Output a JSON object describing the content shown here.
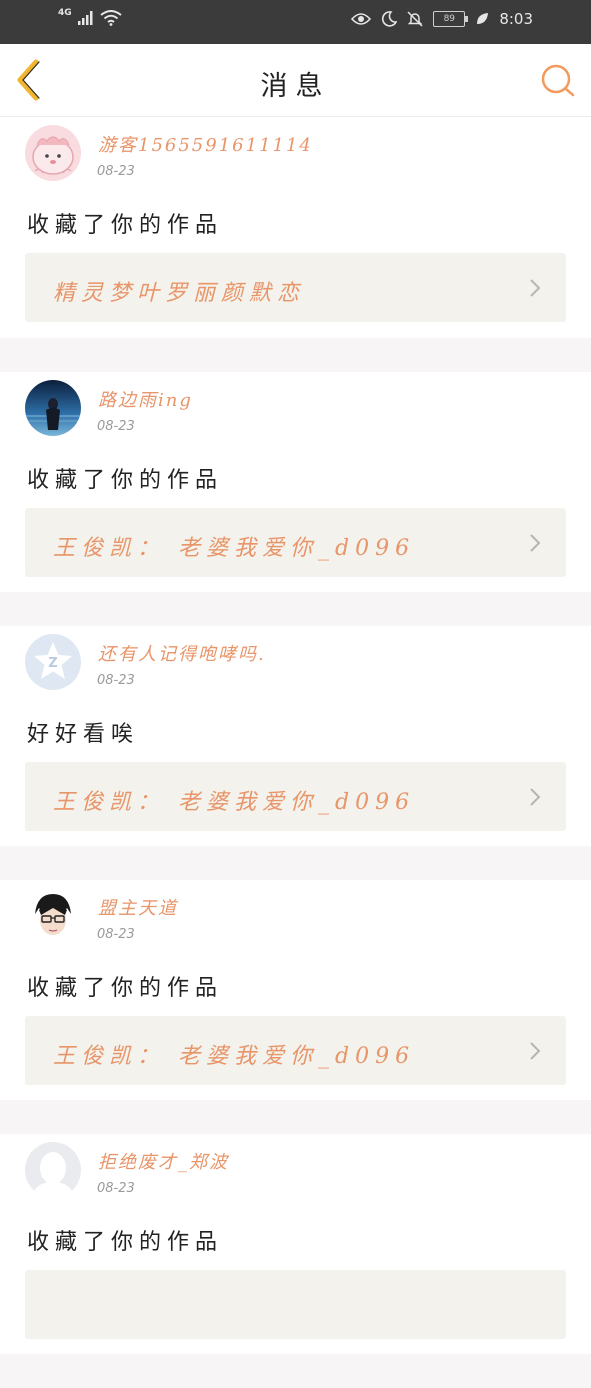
{
  "status_bar": {
    "network": "4G",
    "battery": "89",
    "time": "8:03"
  },
  "header": {
    "title": "消息"
  },
  "messages": [
    {
      "username": "游客1565591611114",
      "date": "08-23",
      "comment": "收藏了你的作品",
      "work_title": "精灵梦叶罗丽颜默恋"
    },
    {
      "username": "路边雨ing",
      "date": "08-23",
      "comment": "收藏了你的作品",
      "work_title": "王俊凯：  老婆我爱你_d096"
    },
    {
      "username": "还有人记得咆哮吗.",
      "date": "08-23",
      "comment": "好好看唉",
      "work_title": "王俊凯：  老婆我爱你_d096"
    },
    {
      "username": "盟主天道",
      "date": "08-23",
      "comment": "收藏了你的作品",
      "work_title": "王俊凯：  老婆我爱你_d096"
    },
    {
      "username": "拒绝废才_郑波",
      "date": "08-23",
      "comment": "收藏了你的作品",
      "work_title": ""
    }
  ],
  "colors": {
    "accent": "#e8956a",
    "back_arrow": "#f0b52c",
    "search_icon": "#f39b5d",
    "work_bg": "#f3f2ec"
  }
}
